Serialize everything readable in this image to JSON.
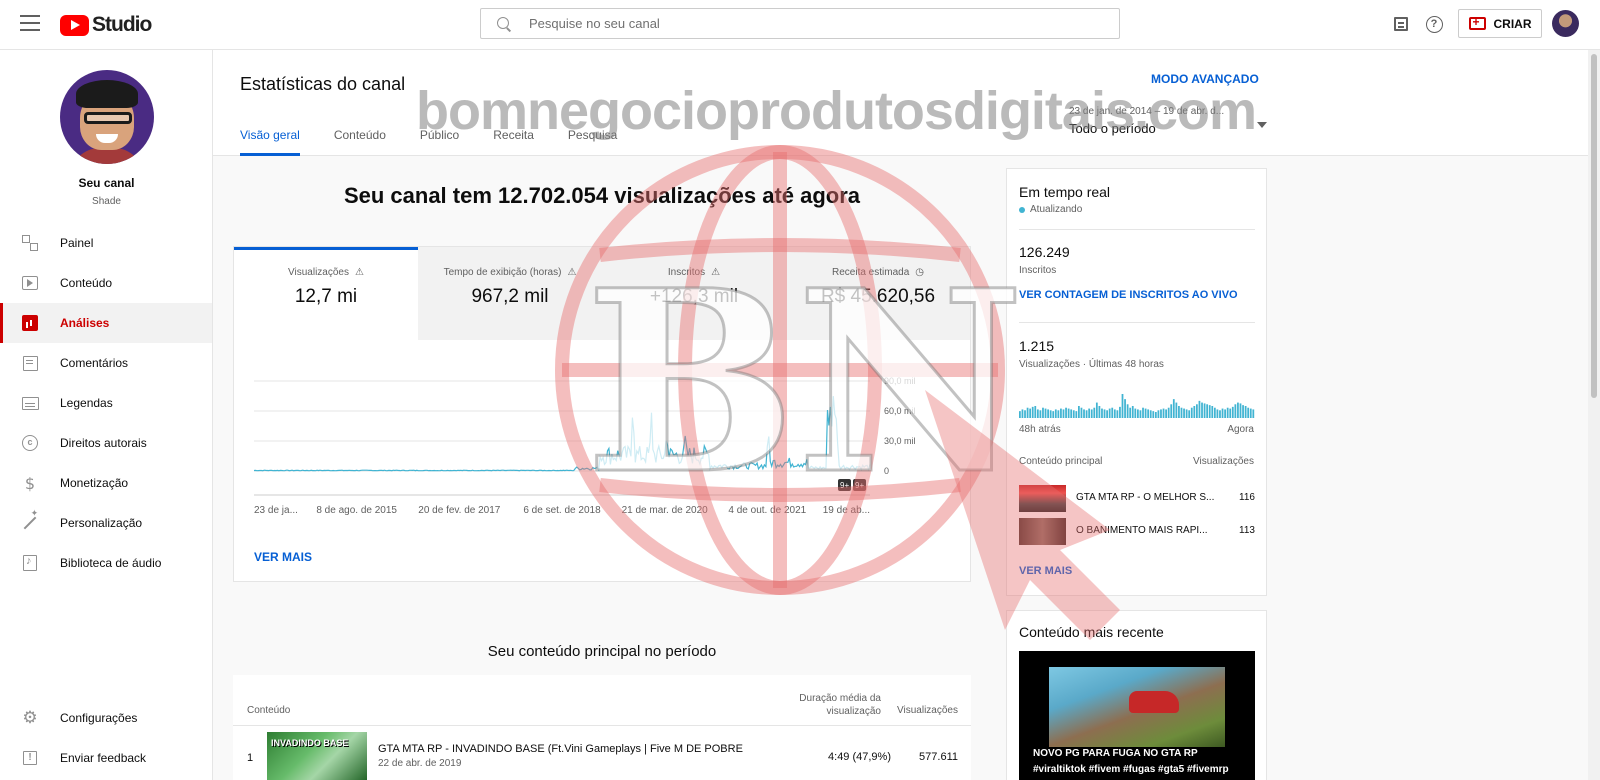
{
  "header": {
    "logo_text": "Studio",
    "search_placeholder": "Pesquise no seu canal",
    "create_label": "CRIAR"
  },
  "sidebar": {
    "channel_label": "Seu canal",
    "channel_handle": "Shade",
    "items": [
      {
        "label": "Painel",
        "icon": "dashboard-icon"
      },
      {
        "label": "Conteúdo",
        "icon": "content-icon"
      },
      {
        "label": "Análises",
        "icon": "analytics-icon",
        "active": true
      },
      {
        "label": "Comentários",
        "icon": "comments-icon"
      },
      {
        "label": "Legendas",
        "icon": "subtitles-icon"
      },
      {
        "label": "Direitos autorais",
        "icon": "copyright-icon"
      },
      {
        "label": "Monetização",
        "icon": "dollar-icon"
      },
      {
        "label": "Personalização",
        "icon": "magic-wand-icon"
      },
      {
        "label": "Biblioteca de áudio",
        "icon": "audio-library-icon"
      }
    ],
    "bottom_items": [
      {
        "label": "Configurações",
        "icon": "gear-icon"
      },
      {
        "label": "Enviar feedback",
        "icon": "feedback-icon"
      }
    ]
  },
  "main": {
    "title": "Estatísticas do canal",
    "advanced_mode": "MODO AVANÇADO",
    "tabs": [
      "Visão geral",
      "Conteúdo",
      "Público",
      "Receita",
      "Pesquisa"
    ],
    "date_range": "23 de jan. de 2014 – 19 de abr. d...",
    "date_value": "Todo o período",
    "headline": "Seu canal tem 12.702.054 visualizações até agora",
    "metrics": [
      {
        "label": "Visualizações",
        "value": "12,7 mi",
        "icon": "warning-icon"
      },
      {
        "label": "Tempo de exibição (horas)",
        "value": "967,2 mil",
        "icon": "warning-icon"
      },
      {
        "label": "Inscritos",
        "value": "+126,3 mil",
        "icon": "warning-icon"
      },
      {
        "label": "Receita estimada",
        "value": "R$ 45.620,56",
        "icon": "clock-icon"
      }
    ],
    "see_more": "VER MAIS",
    "top_content_title": "Seu conteúdo principal no período",
    "table": {
      "col_content": "Conteúdo",
      "col_duration": "Duração média da visualização",
      "col_views": "Visualizações",
      "rows": [
        {
          "rank": "1",
          "thumb_text": "INVADINDO BASE",
          "title": "GTA MTA RP - INVADINDO BASE (Ft.Vini Gameplays | Five M DE POBRE",
          "date": "22 de abr. de 2019",
          "duration": "4:49  (47,9%)",
          "views": "577.611"
        }
      ]
    }
  },
  "chart_data": {
    "type": "line",
    "x_tick_labels": [
      "23 de ja...",
      "8 de ago. de 2015",
      "20 de fev. de 2017",
      "6 de set. de 2018",
      "21 de mar. de 2020",
      "4 de out. de 2021",
      "19 de ab..."
    ],
    "y_tick_labels": [
      "90,0 mil",
      "60,0 mil",
      "30,0 mil",
      "0"
    ],
    "ylim": [
      0,
      90000
    ],
    "markers": [
      "9+",
      "9+"
    ],
    "color": "#41b4d2",
    "segments": [
      {
        "from": 0.0,
        "to": 0.52,
        "level": 500
      },
      {
        "from": 0.52,
        "to": 0.56,
        "level": 2500
      },
      {
        "from": 0.56,
        "to": 0.74,
        "level": 15000
      },
      {
        "from": 0.74,
        "to": 0.84,
        "level": 5000
      },
      {
        "from": 0.84,
        "to": 0.9,
        "level": 8000
      },
      {
        "from": 0.9,
        "to": 0.93,
        "level": 3000
      },
      {
        "from": 0.93,
        "to": 0.95,
        "level": 40000
      },
      {
        "from": 0.95,
        "to": 1.0,
        "level": 4000
      }
    ],
    "spikes": [
      {
        "x": 0.615,
        "value": 65000
      },
      {
        "x": 0.645,
        "value": 62000
      },
      {
        "x": 0.67,
        "value": 40000
      },
      {
        "x": 0.7,
        "value": 35000
      },
      {
        "x": 0.835,
        "value": 42000
      },
      {
        "x": 0.935,
        "value": 78000
      },
      {
        "x": 0.94,
        "value": 85000
      }
    ]
  },
  "realtime": {
    "title": "Em tempo real",
    "status": "Atualizando",
    "subscribers_value": "126.249",
    "subscribers_label": "Inscritos",
    "subscribers_link": "VER CONTAGEM DE INSCRITOS AO VIVO",
    "views_value": "1.215",
    "views_label": "Visualizações · Últimas 48 horas",
    "spark_start": "48h atrás",
    "spark_end": "Agora",
    "spark_values": [
      8,
      10,
      9,
      12,
      11,
      13,
      14,
      10,
      9,
      12,
      11,
      10,
      9,
      8,
      10,
      9,
      11,
      10,
      12,
      11,
      10,
      9,
      8,
      14,
      12,
      10,
      9,
      11,
      10,
      12,
      18,
      14,
      11,
      10,
      9,
      11,
      12,
      10,
      9,
      13,
      28,
      22,
      16,
      12,
      14,
      11,
      10,
      9,
      12,
      11,
      10,
      9,
      8,
      7,
      9,
      10,
      11,
      10,
      12,
      16,
      22,
      18,
      14,
      12,
      11,
      10,
      9,
      12,
      14,
      16,
      20,
      18,
      17,
      16,
      15,
      14,
      12,
      10,
      9,
      11,
      10,
      12,
      11,
      13,
      16,
      18,
      17,
      15,
      14,
      12,
      11,
      10
    ],
    "col_content": "Conteúdo principal",
    "col_views": "Visualizações",
    "rows": [
      {
        "title": "GTA MTA RP - O MELHOR S...",
        "views": "116"
      },
      {
        "title": "O BANIMENTO MAIS RÁPI...",
        "views": "113"
      }
    ],
    "see_more": "VER MAIS"
  },
  "recent": {
    "title": "Conteúdo mais recente",
    "caption_line1": "NOVO PG PARA FUGA NO GTA RP",
    "caption_line2": "#viraltiktok #fivem #fugas #gta5 #fivemrp"
  },
  "watermark": {
    "text": "bomnegocioprodutosdigitais.com",
    "logo_letters": "BN"
  }
}
